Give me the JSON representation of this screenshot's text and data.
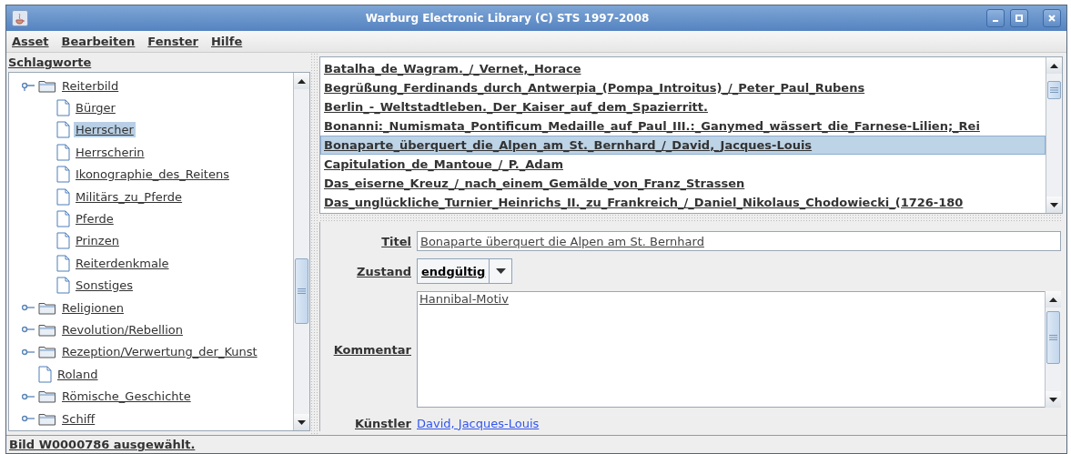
{
  "window": {
    "title": "Warburg Electronic Library (C) STS 1997-2008"
  },
  "menu": [
    "Asset",
    "Bearbeiten",
    "Fenster",
    "Hilfe"
  ],
  "tree": {
    "title": "Schlagworte",
    "items": [
      {
        "label": "Reiterbild",
        "kind": "folder",
        "expanded": true,
        "selected": false,
        "children": [
          {
            "label": "Bürger",
            "kind": "leaf",
            "selected": false
          },
          {
            "label": "Herrscher",
            "kind": "leaf",
            "selected": true
          },
          {
            "label": "Herrscherin",
            "kind": "leaf",
            "selected": false
          },
          {
            "label": "Ikonographie_des_Reitens",
            "kind": "leaf",
            "selected": false
          },
          {
            "label": "Militärs_zu_Pferde",
            "kind": "leaf",
            "selected": false
          },
          {
            "label": "Pferde",
            "kind": "leaf",
            "selected": false
          },
          {
            "label": "Prinzen",
            "kind": "leaf",
            "selected": false
          },
          {
            "label": "Reiterdenkmale",
            "kind": "leaf",
            "selected": false
          },
          {
            "label": "Sonstiges",
            "kind": "leaf",
            "selected": false
          }
        ]
      },
      {
        "label": "Religionen",
        "kind": "folder",
        "expanded": false,
        "selected": false
      },
      {
        "label": "Revolution/Rebellion",
        "kind": "folder",
        "expanded": false,
        "selected": false
      },
      {
        "label": "Rezeption/Verwertung_der_Kunst",
        "kind": "folder",
        "expanded": false,
        "selected": false
      },
      {
        "label": "Roland",
        "kind": "leaf",
        "selected": false
      },
      {
        "label": "Römische_Geschichte",
        "kind": "folder",
        "expanded": false,
        "selected": false
      },
      {
        "label": "Schiff",
        "kind": "folder",
        "expanded": false,
        "selected": false
      }
    ]
  },
  "assets": [
    {
      "label": "Batalha_de_Wagram._/_Vernet,_Horace",
      "selected": false
    },
    {
      "label": "Begrüßung_Ferdinands_durch_Antwerpia_(Pompa_Introitus)_/_Peter_Paul_Rubens",
      "selected": false
    },
    {
      "label": "Berlin_-_Weltstadtleben._Der_Kaiser_auf_dem_Spazierritt.",
      "selected": false
    },
    {
      "label": "Bonanni:_Numismata_Pontificum_Medaille_auf_Paul_III.:_Ganymed_wässert_die_Farnese-Lilien;_Rei",
      "selected": false
    },
    {
      "label": "Bonaparte_überquert_die_Alpen_am_St._Bernhard_/_David,_Jacques-Louis",
      "selected": true
    },
    {
      "label": "Capitulation_de_Mantoue_/_P._Adam",
      "selected": false
    },
    {
      "label": "Das_eiserne_Kreuz_/_nach_einem_Gemälde_von_Franz_Strassen",
      "selected": false
    },
    {
      "label": "Das_unglückliche_Turnier_Heinrichs_II._zu_Frankreich_/_Daniel_Nikolaus_Chodowiecki_(1726-180",
      "selected": false
    }
  ],
  "details": {
    "title": {
      "label": "Titel",
      "value": "Bonaparte überquert die Alpen am St. Bernhard"
    },
    "state": {
      "label": "Zustand",
      "value": "endgültig"
    },
    "comment": {
      "label": "Kommentar",
      "value": "Hannibal-Motiv"
    },
    "artist": {
      "label": "Künstler",
      "value": "David, Jacques-Louis"
    }
  },
  "status_bar": "Bild W0000786 ausgewählt."
}
